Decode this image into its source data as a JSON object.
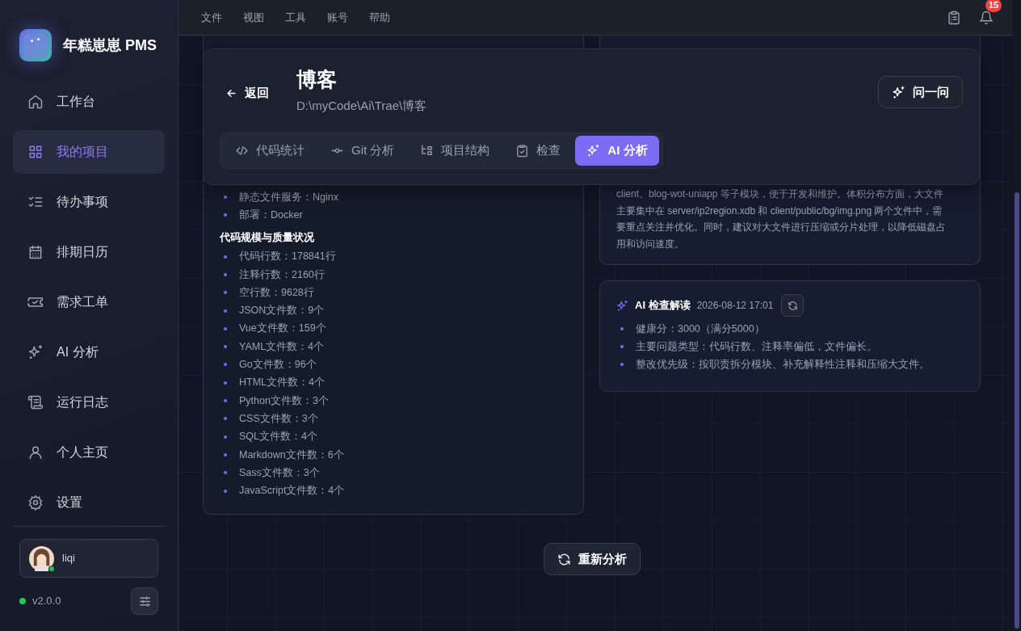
{
  "app": {
    "name": "年糕崽崽 PMS",
    "version": "v2.0.0",
    "online": true
  },
  "sidebar": {
    "items": [
      {
        "label": "工作台",
        "kind": "home",
        "selected": false
      },
      {
        "label": "我的项目",
        "kind": "grid",
        "selected": true
      },
      {
        "label": "待办事项",
        "kind": "todo",
        "selected": false
      },
      {
        "label": "排期日历",
        "kind": "calendar",
        "selected": false
      },
      {
        "label": "需求工单",
        "kind": "ticket",
        "selected": false
      },
      {
        "label": "AI 分析",
        "kind": "sparkles",
        "selected": false
      },
      {
        "label": "运行日志",
        "kind": "scroll",
        "selected": false
      },
      {
        "label": "个人主页",
        "kind": "user",
        "selected": false
      },
      {
        "label": "设置",
        "kind": "settings",
        "selected": false
      }
    ]
  },
  "user": {
    "name": "liqi",
    "online": true
  },
  "menu": [
    "文件",
    "视图",
    "工具",
    "账号",
    "帮助"
  ],
  "notifications": {
    "count": "15"
  },
  "project": {
    "back": "返回",
    "title": "博客",
    "path": "D:\\myCode\\Ai\\Trae\\博客",
    "ask": "问一问"
  },
  "tabs": [
    {
      "label": "代码统计",
      "kind": "code",
      "selected": false
    },
    {
      "label": "Git 分析",
      "kind": "commit",
      "selected": false
    },
    {
      "label": "项目结构",
      "kind": "structure",
      "selected": false
    },
    {
      "label": "检查",
      "kind": "clipboard",
      "selected": false
    },
    {
      "label": "AI 分析",
      "kind": "sparkles",
      "selected": true
    }
  ],
  "stats_card": {
    "items_top": [
      "静态文件服务：Nginx",
      "部署：Docker"
    ],
    "heading": "代码规模与质量状况",
    "items": [
      "代码行数：178841行",
      "注释行数：2160行",
      "空行数：9628行",
      "JSON文件数：9个",
      "Vue文件数：159个",
      "YAML文件数：4个",
      "Go文件数：96个",
      "HTML文件数：4个",
      "Python文件数：3个",
      "CSS文件数：3个",
      "SQL文件数：4个",
      "Markdown文件数：6个",
      "Sass文件数：3个",
      "JavaScript文件数：4个"
    ]
  },
  "summary_card": {
    "lines": [
      "client、blog-wot-uniapp 等子模块，便于开发和维护。体积分布方面，大文件",
      "主要集中在 server/ip2region.xdb 和 client/public/bg/img.png 两个文件中，需",
      "要重点关注并优化。同时，建议对大文件进行压缩或分片处理，以降低磁盘占",
      "用和访问速度。"
    ]
  },
  "inspection_card": {
    "title": "AI 检查解读",
    "time": "2026-08-12 17:01",
    "items": [
      "健康分：3000（满分5000）",
      "主要问题类型：代码行数、注释率偏低，文件偏长。",
      "整改优先级：按职责拆分模块、补充解释性注释和压缩大文件。"
    ]
  },
  "reanalyze": "重新分析"
}
